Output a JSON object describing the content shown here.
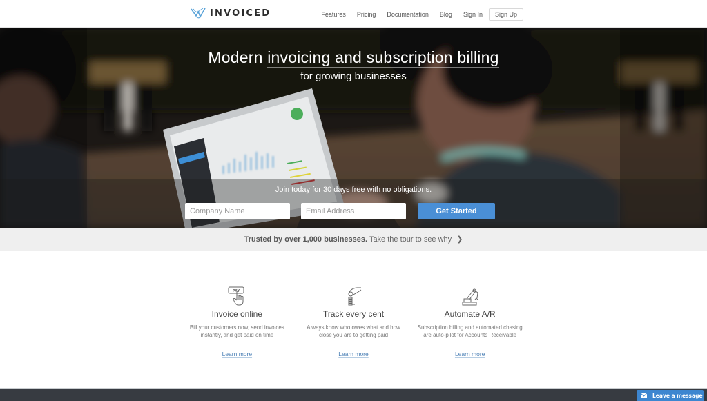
{
  "nav": {
    "brand": "INVOICED",
    "links": [
      "Features",
      "Pricing",
      "Documentation",
      "Blog",
      "Sign In"
    ],
    "signup": "Sign Up"
  },
  "hero": {
    "title_pre": "Modern ",
    "title_underlined": "invoicing and subscription billing",
    "subtitle": "for growing businesses",
    "cta_text": "Join today for 30 days free with no obligations.",
    "company_placeholder": "Company Name",
    "email_placeholder": "Email Address",
    "button": "Get Started"
  },
  "trust": {
    "bold": "Trusted by over 1,000 businesses.",
    "link": "Take the tour to see why",
    "icon": "chevron-right-icon"
  },
  "features": [
    {
      "icon": "pay-button-hand-icon",
      "title": "Invoice online",
      "desc": "Bill your customers now, send invoices instantly, and get paid on time",
      "link": "Learn more"
    },
    {
      "icon": "hand-coins-icon",
      "title": "Track every cent",
      "desc": "Always know who owes what and how close you are to getting paid",
      "link": "Learn more"
    },
    {
      "icon": "robot-arm-icon",
      "title": "Automate A/R",
      "desc": "Subscription billing and automated chasing are auto-pilot for Accounts Receivable",
      "link": "Learn more"
    }
  ],
  "chat": {
    "label": "Leave a message",
    "icon": "envelope-icon"
  },
  "colors": {
    "primary_button": "#4a8fd6",
    "link": "#4a7fb5",
    "footer": "#373b41",
    "chat": "#3d86d0"
  }
}
